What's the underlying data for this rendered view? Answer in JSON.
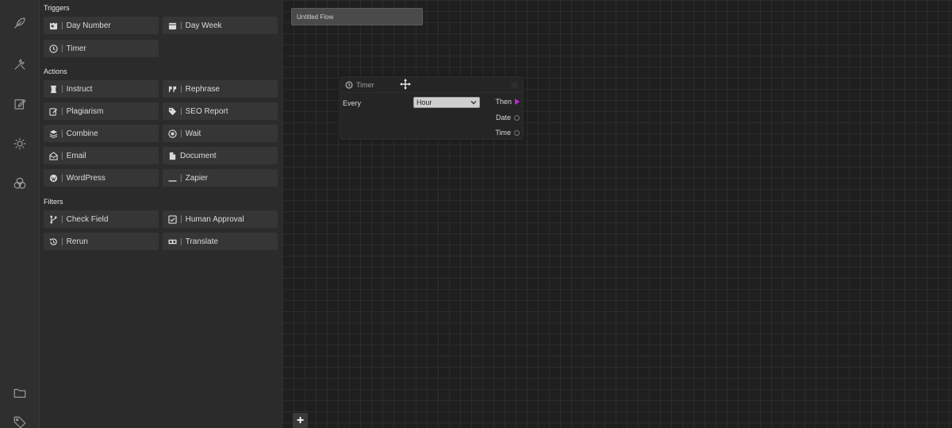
{
  "panel": {
    "triggers": {
      "title": "Triggers",
      "items": [
        {
          "label": "Day Number",
          "icon": "calendar-day-icon"
        },
        {
          "label": "Day Week",
          "icon": "calendar-icon"
        },
        {
          "label": "Timer",
          "icon": "clock-icon"
        }
      ]
    },
    "actions": {
      "title": "Actions",
      "items": [
        {
          "label": "Instruct",
          "icon": "scroll-icon"
        },
        {
          "label": "Rephrase",
          "icon": "quote-icon"
        },
        {
          "label": "Plagiarism",
          "icon": "edit-icon"
        },
        {
          "label": "SEO Report",
          "icon": "tags-icon"
        },
        {
          "label": "Combine",
          "icon": "layers-icon"
        },
        {
          "label": "Wait",
          "icon": "stop-circle-icon"
        },
        {
          "label": "Email",
          "icon": "envelope-open-icon"
        },
        {
          "label": "Document",
          "icon": "file-icon"
        },
        {
          "label": "WordPress",
          "icon": "wordpress-icon"
        },
        {
          "label": "Zapier",
          "icon": "underscore-icon"
        }
      ]
    },
    "filters": {
      "title": "Filters",
      "items": [
        {
          "label": "Check Field",
          "icon": "branch-icon"
        },
        {
          "label": "Human Approval",
          "icon": "checkbox-icon"
        },
        {
          "label": "Rerun",
          "icon": "history-icon"
        },
        {
          "label": "Translate",
          "icon": "language-icon"
        }
      ]
    },
    "separator": "|"
  },
  "canvas": {
    "flow_title": "Untitled Flow",
    "node": {
      "title": "Timer",
      "field_label": "Every",
      "select_value": "Hour",
      "outputs": [
        {
          "label": "Then",
          "type": "exec"
        },
        {
          "label": "Date",
          "type": "data"
        },
        {
          "label": "Time",
          "type": "data"
        }
      ]
    },
    "add_label": "+"
  },
  "colors": {
    "exec_port": "#c026d3",
    "canvas_bg": "#1f1f1f",
    "panel_bg": "#2b2b2b"
  }
}
